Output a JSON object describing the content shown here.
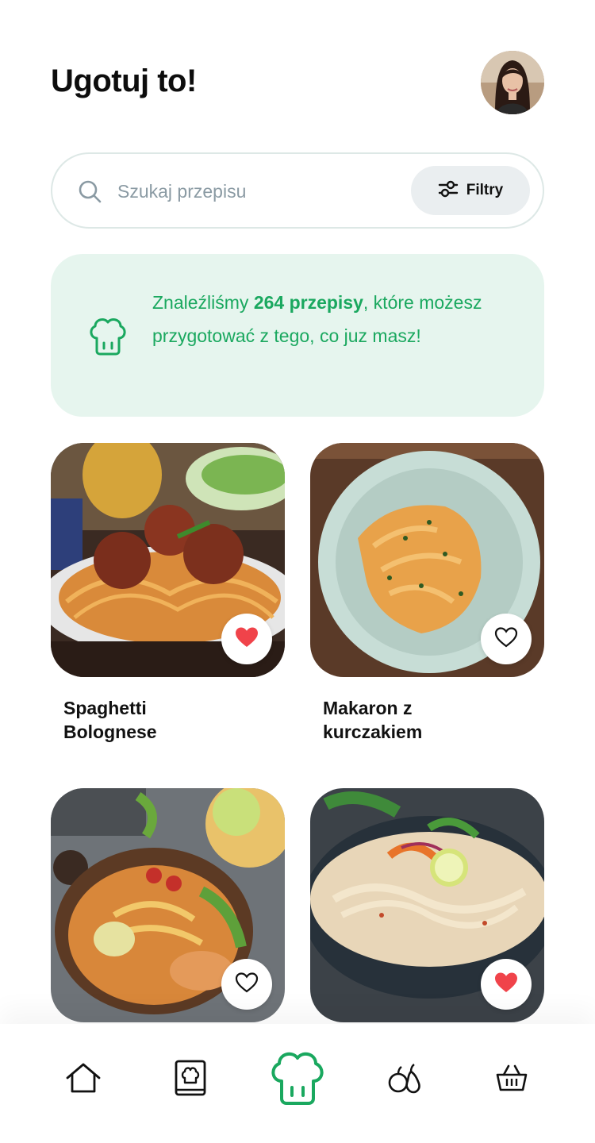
{
  "header": {
    "title": "Ugotuj to!"
  },
  "search": {
    "placeholder": "Szukaj przepisu",
    "filter_label": "Filtry"
  },
  "banner": {
    "text_before": "Znaleźliśmy ",
    "count_text": "264 przepisy",
    "text_after": ", które możesz przygotować z tego, co juz masz!"
  },
  "recipes": [
    {
      "name": "Spaghetti Bolognese",
      "favorite": true
    },
    {
      "name": "Makaron z kurczakiem",
      "favorite": false
    },
    {
      "name": "",
      "favorite": false
    },
    {
      "name": "",
      "favorite": true
    }
  ],
  "nav": {
    "items": [
      "home-icon",
      "cookbook-icon",
      "chef-hat-icon",
      "fruits-icon",
      "basket-icon"
    ],
    "active": "chef-hat-icon"
  },
  "colors": {
    "accent": "#1aa85f",
    "banner_bg": "#e6f5ee",
    "heart": "#f0434a"
  }
}
